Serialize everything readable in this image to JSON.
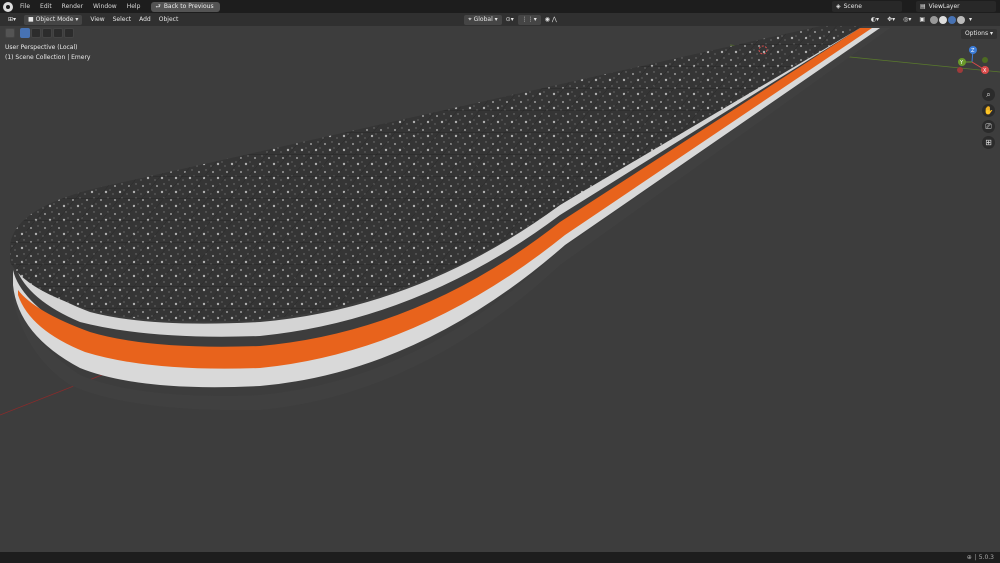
{
  "menubar": {
    "items": [
      "File",
      "Edit",
      "Render",
      "Window",
      "Help"
    ],
    "back_button": "Back to Previous",
    "scene": "Scene",
    "view_layer": "ViewLayer"
  },
  "header": {
    "mode": "Object Mode",
    "menus": [
      "View",
      "Select",
      "Add",
      "Object"
    ],
    "orientation": "Global"
  },
  "viewport": {
    "perspective_label": "User Perspective (Local)",
    "collection_label": "(1) Scene Collection | Emery",
    "options_label": "Options",
    "gizmo_axes": [
      "X",
      "Y",
      "Z"
    ]
  },
  "statusbar": {
    "version": "5.0.3"
  },
  "colors": {
    "accent": "#4772b3",
    "stripe_orange": "#e8631c",
    "stripe_white": "#dcdcdc",
    "grit_dark": "#333333"
  }
}
